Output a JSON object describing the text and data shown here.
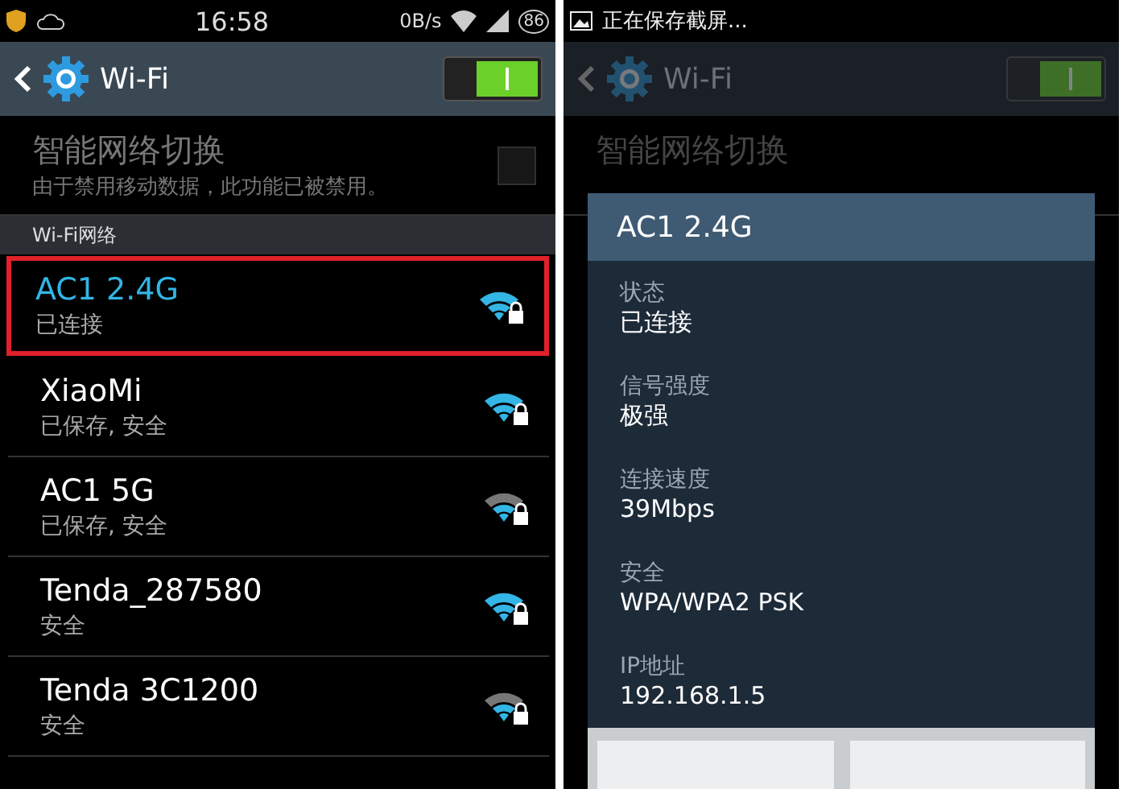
{
  "left": {
    "status_bar": {
      "time": "16:58",
      "speed": "0B/s",
      "battery": "86"
    },
    "action_bar": {
      "title": "Wi-Fi",
      "switch_on": true
    },
    "smart_switch": {
      "title": "智能网络切换",
      "subtitle": "由于禁用移动数据，此功能已被禁用。",
      "checked": false,
      "disabled": true
    },
    "section_header": "Wi-Fi网络",
    "networks": [
      {
        "name": "AC1 2.4G",
        "status": "已连接",
        "connected": true,
        "highlighted": true,
        "weak_signal": false
      },
      {
        "name": "XiaoMi",
        "status": "已保存, 安全",
        "connected": false,
        "highlighted": false,
        "weak_signal": false
      },
      {
        "name": "AC1 5G",
        "status": "已保存, 安全",
        "connected": false,
        "highlighted": false,
        "weak_signal": true
      },
      {
        "name": "Tenda_287580",
        "status": "安全",
        "connected": false,
        "highlighted": false,
        "weak_signal": false
      },
      {
        "name": "Tenda 3C1200",
        "status": "安全",
        "connected": false,
        "highlighted": false,
        "weak_signal": true
      }
    ]
  },
  "right": {
    "status_bar": {
      "notification": "正在保存截屏..."
    },
    "action_bar": {
      "title": "Wi-Fi",
      "switch_on": true
    },
    "smart_switch_title": "智能网络切换",
    "dialog": {
      "title": "AC1 2.4G",
      "fields": [
        {
          "label": "状态",
          "value": "已连接"
        },
        {
          "label": "信号强度",
          "value": "极强"
        },
        {
          "label": "连接速度",
          "value": "39Mbps"
        },
        {
          "label": "安全",
          "value": "WPA/WPA2 PSK"
        },
        {
          "label": "IP地址",
          "value": "192.168.1.5"
        }
      ]
    }
  }
}
